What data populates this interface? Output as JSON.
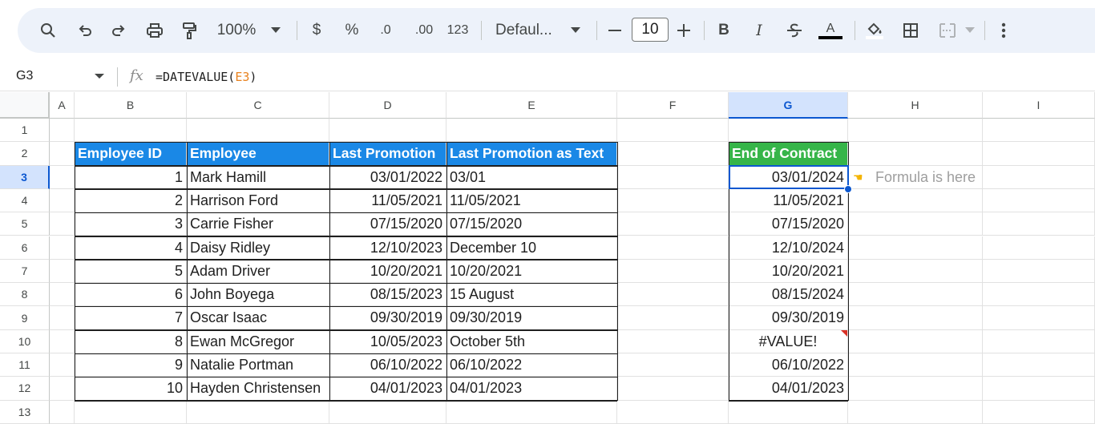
{
  "toolbar": {
    "zoom": "100%",
    "currency": "$",
    "percent": "%",
    "decrease_decimal": ".0",
    "increase_decimal": ".00",
    "format_123": "123",
    "font": "Defaul...",
    "font_size": "10",
    "bold": "B",
    "italic": "I",
    "text_color": "A"
  },
  "formula_bar": {
    "cell_ref": "G3",
    "fx": "fx",
    "formula_prefix": "=DATEVALUE(",
    "formula_ref": "E3",
    "formula_suffix": ")"
  },
  "columns": [
    "A",
    "B",
    "C",
    "D",
    "E",
    "F",
    "G",
    "H",
    "I"
  ],
  "rows": [
    "1",
    "2",
    "3",
    "4",
    "5",
    "6",
    "7",
    "8",
    "9",
    "10",
    "11",
    "12",
    "13"
  ],
  "table": {
    "headers": [
      "Employee ID",
      "Employee",
      "Last Promotion",
      "Last Promotion as Text"
    ],
    "rows": [
      [
        "1",
        "Mark Hamill",
        "03/01/2022",
        "03/01"
      ],
      [
        "2",
        "Harrison Ford",
        "11/05/2021",
        "11/05/2021"
      ],
      [
        "3",
        "Carrie Fisher",
        "07/15/2020",
        "07/15/2020"
      ],
      [
        "4",
        "Daisy Ridley",
        "12/10/2023",
        "December 10"
      ],
      [
        "5",
        "Adam Driver",
        "10/20/2021",
        "10/20/2021"
      ],
      [
        "6",
        "John Boyega",
        "08/15/2023",
        "15 August"
      ],
      [
        "7",
        "Oscar Isaac",
        "09/30/2019",
        "09/30/2019"
      ],
      [
        "8",
        "Ewan McGregor",
        "10/05/2023",
        "October 5th"
      ],
      [
        "9",
        "Natalie Portman",
        "06/10/2022",
        "06/10/2022"
      ],
      [
        "10",
        "Hayden Christensen",
        "04/01/2023",
        "04/01/2023"
      ]
    ]
  },
  "contract": {
    "header": "End of Contract",
    "values": [
      "03/01/2024",
      "11/05/2021",
      "07/15/2020",
      "12/10/2024",
      "10/20/2021",
      "08/15/2024",
      "09/30/2019",
      "#VALUE!",
      "06/10/2022",
      "04/01/2023"
    ]
  },
  "note": "Formula is here",
  "colors": {
    "header_blue": "#1a88e6",
    "header_green": "#36b549",
    "selection": "#0b57d0",
    "error_marker": "#d93025"
  }
}
